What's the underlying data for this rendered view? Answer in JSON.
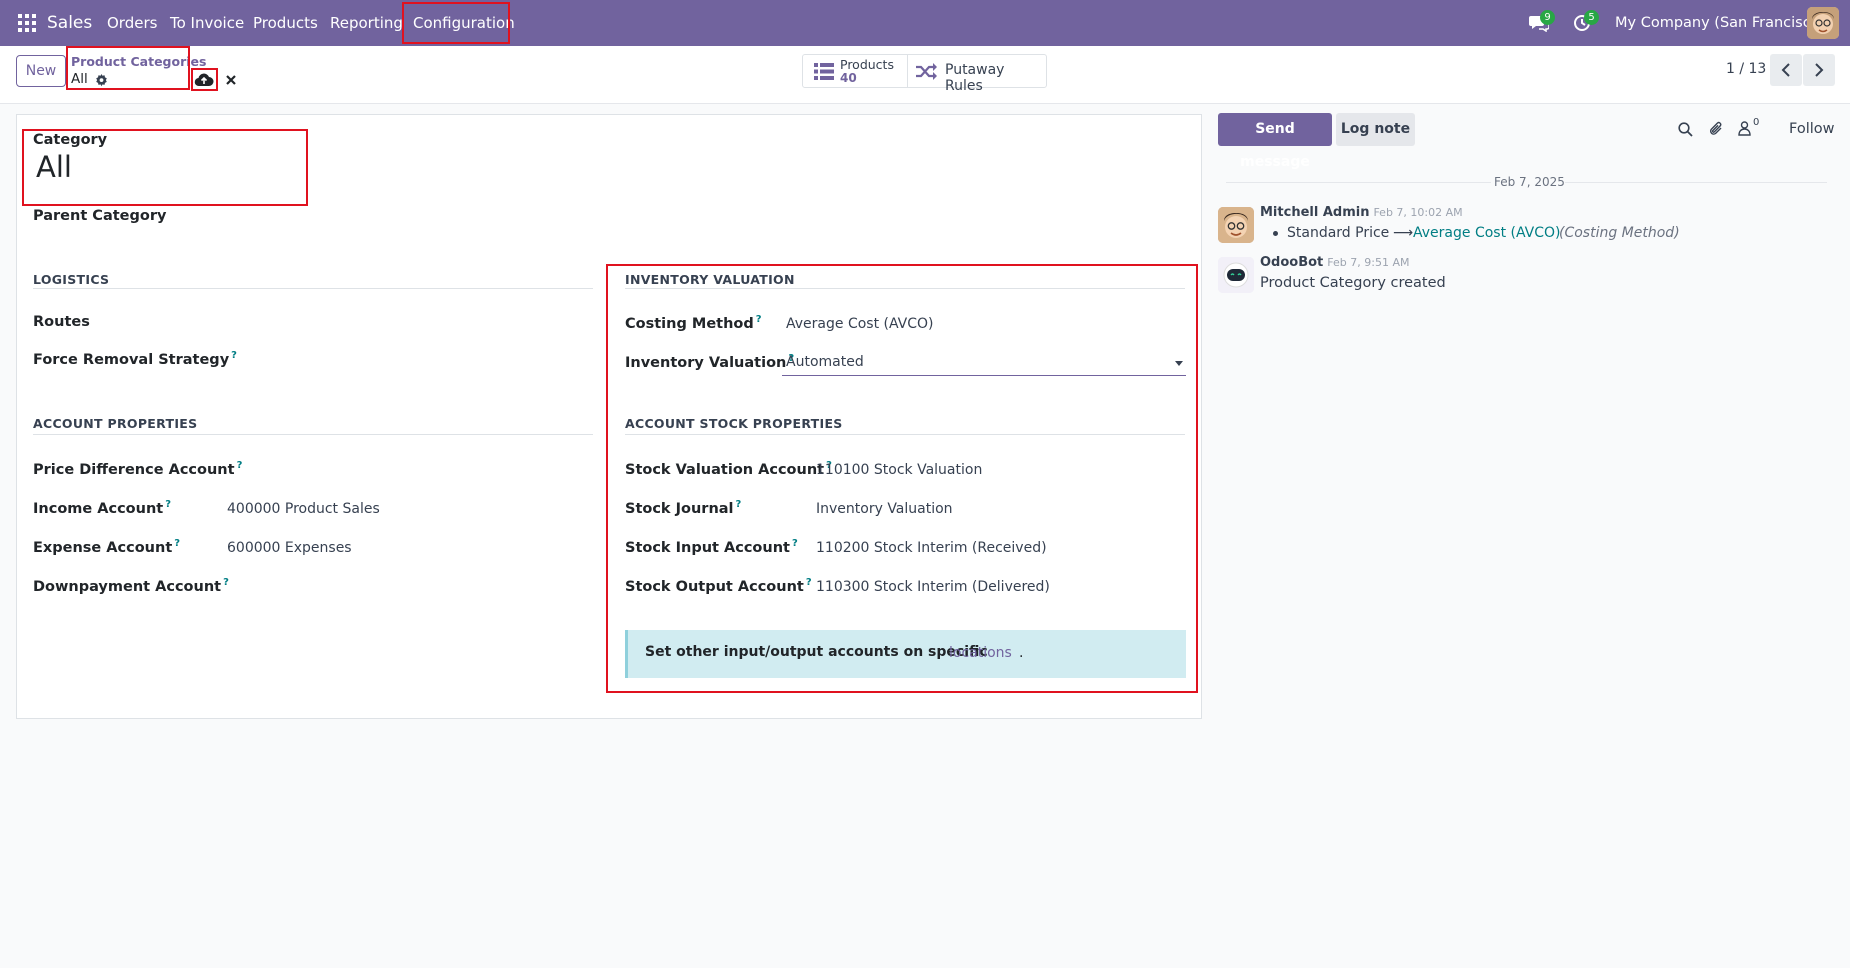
{
  "navbar": {
    "app_name": "Sales",
    "menu": [
      "Orders",
      "To Invoice",
      "Products",
      "Reporting",
      "Configuration"
    ],
    "messages_count": "9",
    "activities_count": "5",
    "company": "My Company (San Francisco)",
    "brand_color": "#71639e"
  },
  "control_panel": {
    "new_label": "New",
    "breadcrumb_parent": "Product Categories",
    "breadcrumb_current": "All",
    "products_label": "Products",
    "products_count": "40",
    "putaway_label": "Putaway Rules",
    "pager": "1 / 13"
  },
  "form": {
    "category_label": "Category",
    "category_name": "All",
    "parent_category_label": "Parent Category",
    "logistics": {
      "title": "LOGISTICS",
      "routes_label": "Routes",
      "removal_label": "Force Removal Strategy"
    },
    "inventory_valuation": {
      "title": "INVENTORY VALUATION",
      "costing_label": "Costing Method",
      "costing_value": "Average Cost (AVCO)",
      "valuation_label": "Inventory Valuation",
      "valuation_value": "Automated"
    },
    "account_properties": {
      "title": "ACCOUNT PROPERTIES",
      "price_diff_label": "Price Difference Account",
      "income_label": "Income Account",
      "income_value": "400000 Product Sales",
      "expense_label": "Expense Account",
      "expense_value": "600000 Expenses",
      "downpayment_label": "Downpayment Account"
    },
    "account_stock_properties": {
      "title": "ACCOUNT STOCK PROPERTIES",
      "stock_valuation_label": "Stock Valuation Account",
      "stock_valuation_value": "110100 Stock Valuation",
      "stock_journal_label": "Stock Journal",
      "stock_journal_value": "Inventory Valuation",
      "stock_input_label": "Stock Input Account",
      "stock_input_value": "110200 Stock Interim (Received)",
      "stock_output_label": "Stock Output Account",
      "stock_output_value": "110300 Stock Interim (Delivered)"
    },
    "alert": {
      "text": "Set other input/output accounts on specific",
      "link": "locations",
      "suffix": "."
    },
    "help_mark": "?"
  },
  "chatter": {
    "send_message": "Send message",
    "log_note": "Log note",
    "followers_count": "0",
    "follow_label": "Follow",
    "date_separator": "Feb 7, 2025",
    "messages": [
      {
        "author": "Mitchell Admin",
        "time": "Feb 7, 10:02 AM",
        "old_value": "Standard Price",
        "arrow": "⟶",
        "new_value": "Average Cost (AVCO)",
        "field": "(Costing Method)"
      },
      {
        "author": "OdooBot",
        "time": "Feb 7, 9:51 AM",
        "body": "Product Category created"
      }
    ]
  }
}
